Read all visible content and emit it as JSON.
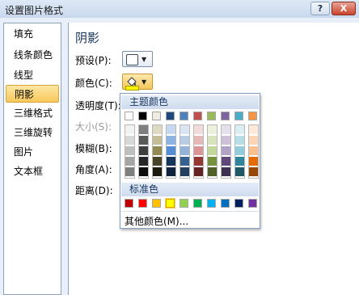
{
  "window": {
    "title": "设置图片格式",
    "help_label": "?",
    "close_label": "X"
  },
  "sidebar": {
    "items": [
      {
        "label": "填充",
        "selected": false
      },
      {
        "label": "线条颜色",
        "selected": false
      },
      {
        "label": "线型",
        "selected": false
      },
      {
        "label": "阴影",
        "selected": true
      },
      {
        "label": "三维格式",
        "selected": false
      },
      {
        "label": "三维旋转",
        "selected": false
      },
      {
        "label": "图片",
        "selected": false
      },
      {
        "label": "文本框",
        "selected": false
      }
    ]
  },
  "panel": {
    "title": "阴影",
    "fields": {
      "preset": "预设(P):",
      "color": "颜色(C):",
      "transparency": "透明度(T):",
      "size": "大小(S):",
      "blur": "模糊(B):",
      "angle": "角度(A):",
      "distance": "距离(D):"
    },
    "color_value": "#fff200"
  },
  "color_popup": {
    "theme_title": "主题颜色",
    "standard_title": "标准色",
    "more_colors": "其他颜色(M)...",
    "theme_top": [
      "#ffffff",
      "#000000",
      "#eeece1",
      "#1f497d",
      "#4f81bd",
      "#c0504d",
      "#9bbb59",
      "#8064a2",
      "#4bacc6",
      "#f79646"
    ],
    "theme_shades": [
      [
        "#f2f2f2",
        "#d8d8d8",
        "#bfbfbf",
        "#a5a5a5",
        "#7f7f7f"
      ],
      [
        "#7f7f7f",
        "#595959",
        "#3f3f3f",
        "#262626",
        "#0c0c0c"
      ],
      [
        "#ddd9c3",
        "#c4bd97",
        "#938953",
        "#494429",
        "#1d1b10"
      ],
      [
        "#c6d9f0",
        "#8db3e2",
        "#548dd4",
        "#17365d",
        "#0f243e"
      ],
      [
        "#dbe5f1",
        "#b8cce4",
        "#95b3d7",
        "#366092",
        "#244061"
      ],
      [
        "#f2dcdb",
        "#e5b9b7",
        "#d99694",
        "#953734",
        "#632423"
      ],
      [
        "#ebf1dd",
        "#d7e3bc",
        "#c3d69b",
        "#76923c",
        "#4f6128"
      ],
      [
        "#e5e0ec",
        "#ccc1d9",
        "#b2a2c7",
        "#5f497a",
        "#3f3151"
      ],
      [
        "#dbeef3",
        "#b7dde8",
        "#92cddc",
        "#31859b",
        "#205867"
      ],
      [
        "#fdeada",
        "#fbd5b5",
        "#fac08f",
        "#e36c09",
        "#974806"
      ]
    ],
    "standard": [
      "#c00000",
      "#ff0000",
      "#ffc000",
      "#ffff00",
      "#92d050",
      "#00b050",
      "#00b0f0",
      "#0070c0",
      "#002060",
      "#7030a0"
    ],
    "standard_selected_index": 3
  }
}
